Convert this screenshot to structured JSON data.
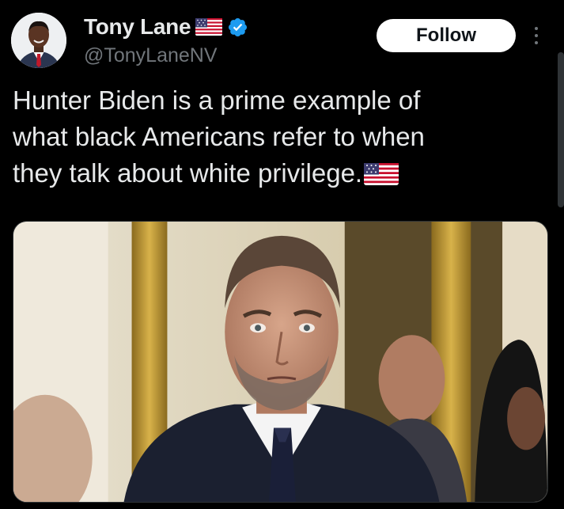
{
  "author": {
    "display_name": "Tony Lane",
    "handle": "@TonyLaneNV",
    "verified": true,
    "name_emoji": "us-flag-icon"
  },
  "actions": {
    "follow_label": "Follow",
    "more_icon": "more-vertical-icon"
  },
  "tweet": {
    "text_lines": [
      "Hunter Biden is a prime example of",
      "what black Americans refer to when",
      "they talk about white privilege."
    ],
    "trailing_emoji": "us-flag-icon"
  },
  "media": {
    "kind": "photo",
    "icon": "photo-image"
  },
  "colors": {
    "background": "#000000",
    "text_primary": "#e7e9ea",
    "text_secondary": "#71767b",
    "verified_blue": "#1d9bf0",
    "follow_bg": "#ffffff"
  }
}
